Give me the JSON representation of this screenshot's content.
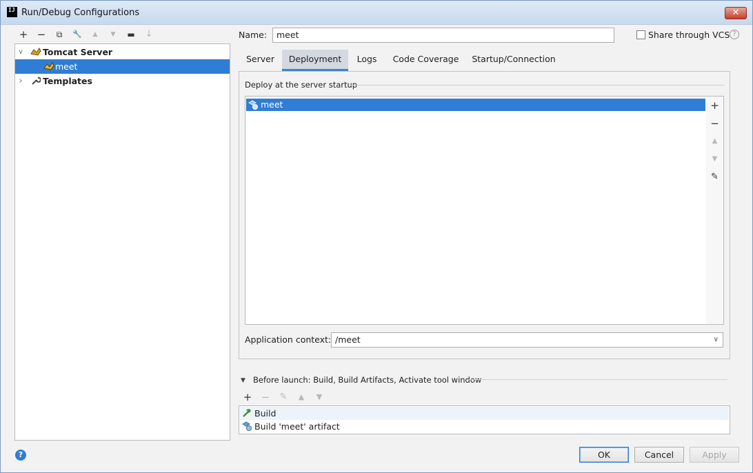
{
  "window": {
    "title": "Run/Debug Configurations",
    "app_icon": "IJ",
    "close_glyph": "✕"
  },
  "left_toolbar": {
    "buttons": [
      {
        "icon": "plus-icon",
        "glyph": "+"
      },
      {
        "icon": "minus-icon",
        "glyph": "−"
      },
      {
        "icon": "copy-icon",
        "glyph": "⧉"
      },
      {
        "icon": "wrench-icon",
        "glyph": "🔧"
      },
      {
        "icon": "arrow-up-icon",
        "glyph": "▲"
      },
      {
        "icon": "arrow-down-icon",
        "glyph": "▼"
      },
      {
        "icon": "folder-icon",
        "glyph": "▬"
      },
      {
        "icon": "sort-icon",
        "glyph": "↓"
      }
    ]
  },
  "tree": {
    "tomcat": "Tomcat Server",
    "meet": "meet",
    "templates": "Templates",
    "chev_open": "∨",
    "chev_closed": "›"
  },
  "name": {
    "label": "Name:",
    "value": "meet"
  },
  "share": {
    "label": "Share through VCS",
    "help": "?"
  },
  "tabs": [
    "Server",
    "Deployment",
    "Logs",
    "Code Coverage",
    "Startup/Connection"
  ],
  "active_tab": "Deployment",
  "deployment": {
    "section_label": "Deploy at the server startup",
    "items": [
      "meet"
    ],
    "side_tools": {
      "add": "+",
      "remove": "−",
      "up": "▲",
      "down": "▼",
      "edit": "✎"
    }
  },
  "context": {
    "label": "Application context:",
    "value": "/meet",
    "arrow": "∨"
  },
  "before_launch": {
    "label": "Before launch: Build, Build Artifacts, Activate tool window",
    "toggle": "▼",
    "toolbar": {
      "add": "+",
      "remove": "−",
      "edit": "✎",
      "up": "▲",
      "down": "▼"
    },
    "items": [
      "Build",
      "Build 'meet' artifact"
    ]
  },
  "footer": {
    "help": "?",
    "ok": "OK",
    "cancel": "Cancel",
    "apply": "Apply"
  }
}
